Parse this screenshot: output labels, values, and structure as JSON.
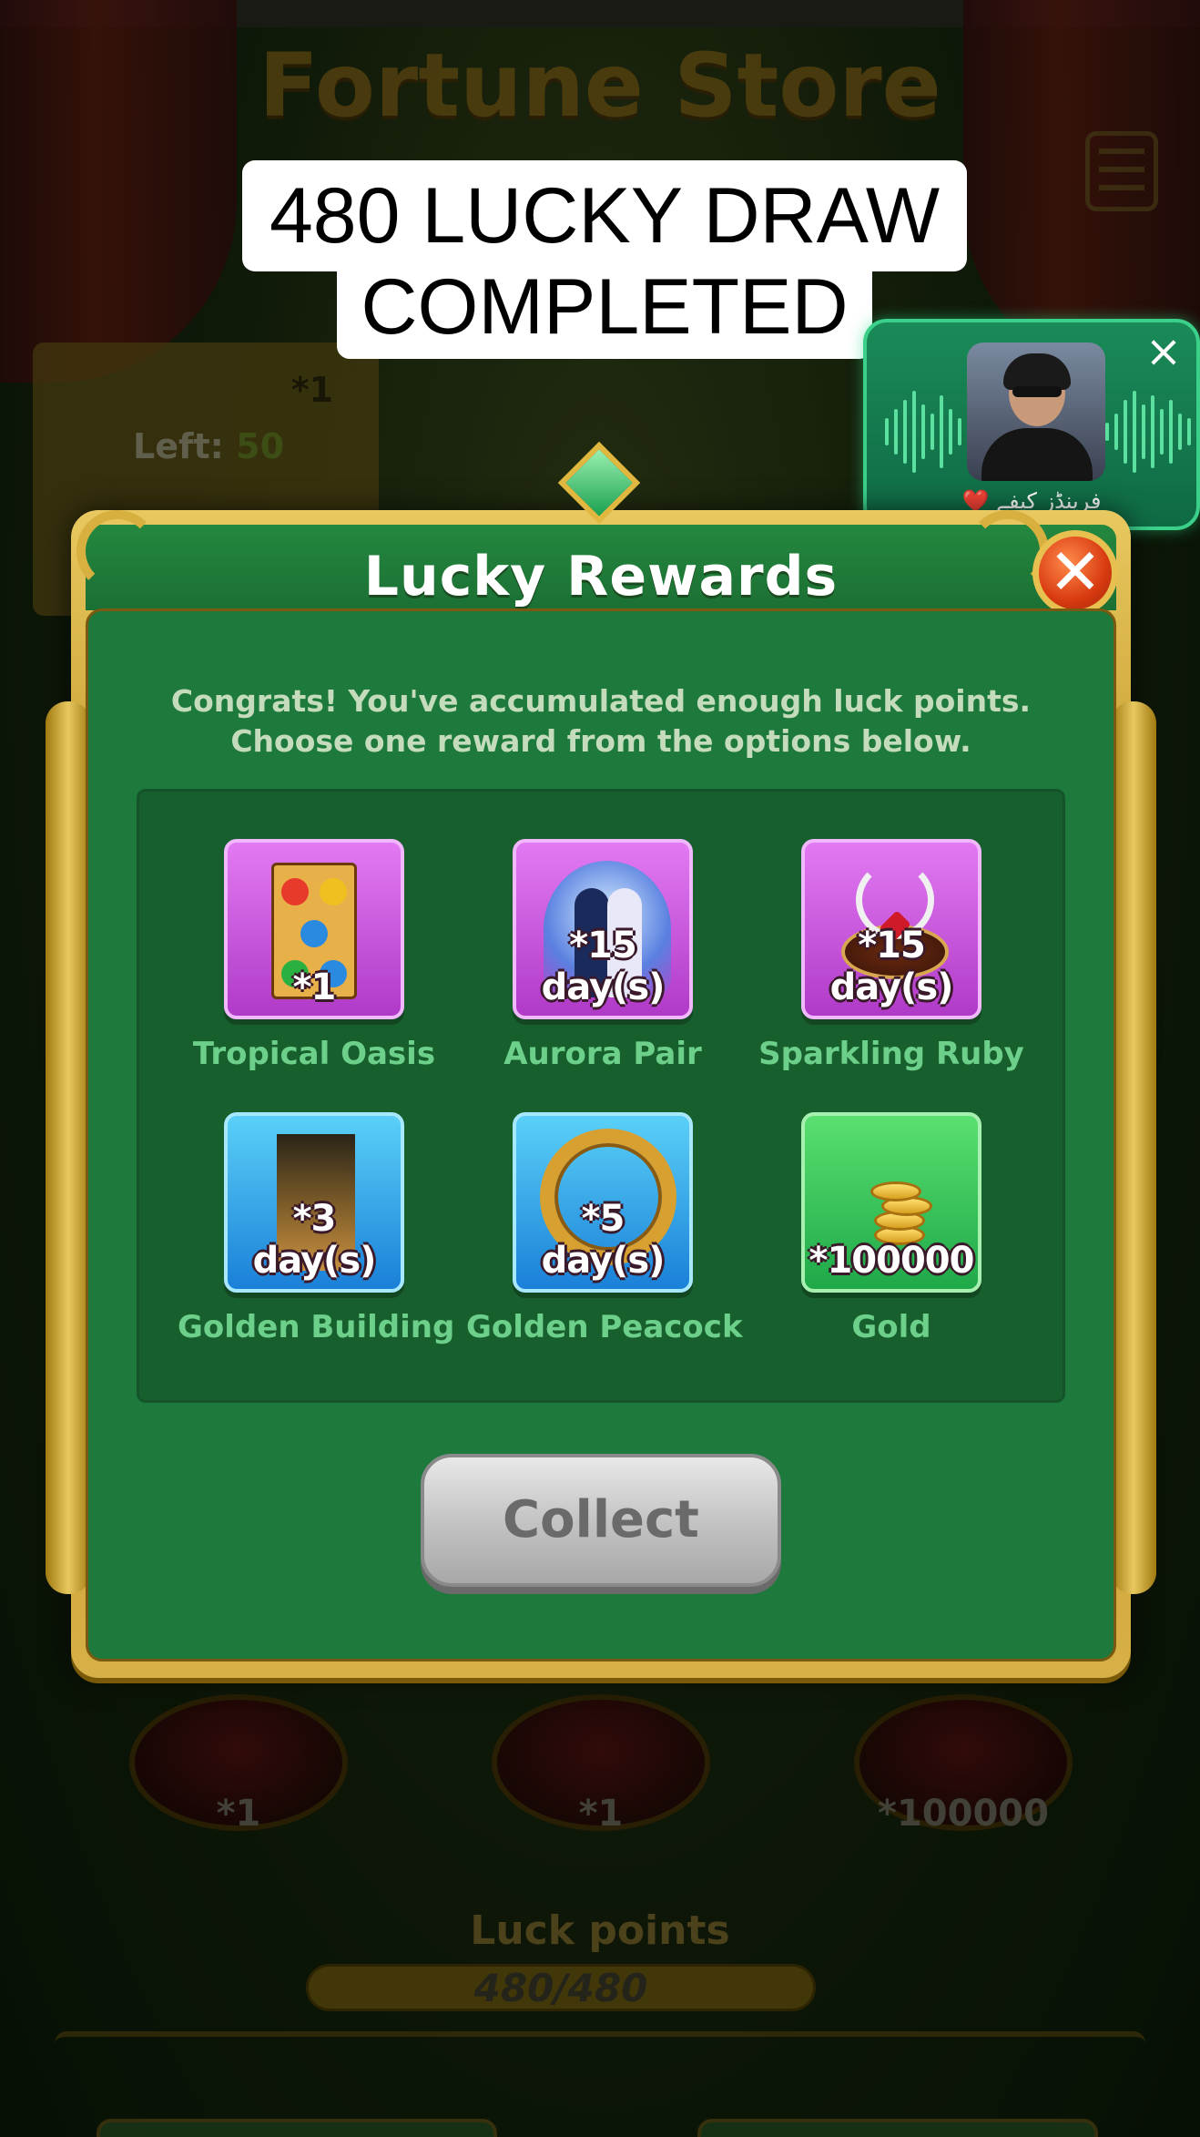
{
  "caption": {
    "line1": "480 LUCKY DRAW",
    "line2": "COMPLETED"
  },
  "background": {
    "store_title": "Fortune Store",
    "card_qty": "*1",
    "card_left_label": "Left:",
    "card_left_value": "50",
    "pedestals": [
      "*1",
      "*1",
      "*100000"
    ],
    "luck_points_label": "Luck points",
    "luck_points_value": "480/480"
  },
  "voice_chat": {
    "close_icon": "×",
    "room_name": "❤️ فرینڈز کیفے"
  },
  "dialog": {
    "title": "Lucky Rewards",
    "close_icon": "✕",
    "description": "Congrats! You've accumulated enough luck points. Choose one reward from the options below.",
    "rewards": [
      {
        "name": "Tropical Oasis",
        "qty": "*1",
        "icon": "ludo-board-icon",
        "color": "#c04ad8"
      },
      {
        "name": "Aurora Pair",
        "qty": "*15 day(s)",
        "icon": "couple-frame-icon",
        "color": "#c04ad8"
      },
      {
        "name": "Sparkling Ruby",
        "qty": "*15 day(s)",
        "icon": "ruby-necklace-icon",
        "color": "#c04ad8"
      },
      {
        "name": "Golden Building",
        "qty": "*3 day(s)",
        "icon": "golden-tower-icon",
        "color": "#2a9ae8"
      },
      {
        "name": "Golden Peacock",
        "qty": "*5 day(s)",
        "icon": "peacock-frame-icon",
        "color": "#2a9ae8"
      },
      {
        "name": "Gold",
        "qty": "*100000",
        "icon": "gold-coins-icon",
        "color": "#2ec050"
      }
    ],
    "collect_label": "Collect"
  }
}
